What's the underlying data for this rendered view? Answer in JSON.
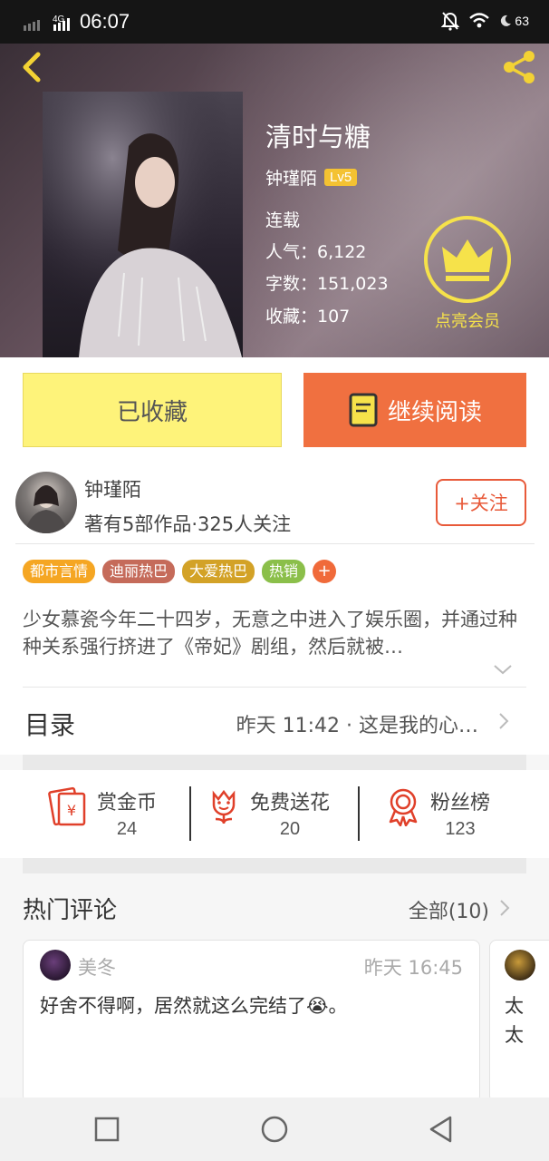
{
  "status_bar": {
    "network": "4G",
    "time": "06:07",
    "battery": "63"
  },
  "book": {
    "title": "清时与糖",
    "author": "钟瑾陌",
    "level": "Lv5",
    "status": "连载",
    "popularity": "人气：6,122",
    "word_count": "字数：151,023",
    "favorites": "收藏：107",
    "vip_label": "点亮会员"
  },
  "actions": {
    "favorited_label": "已收藏",
    "continue_label": "继续阅读"
  },
  "author_info": {
    "name": "钟瑾陌",
    "meta": "著有5部作品·325人关注",
    "follow_label": "+关注"
  },
  "tags": [
    {
      "label": "都市言情",
      "color": "#f5a623"
    },
    {
      "label": "迪丽热巴",
      "color": "#c56b5a"
    },
    {
      "label": "大爱热巴",
      "color": "#d3a227"
    },
    {
      "label": "热销",
      "color": "#8bbf4a"
    }
  ],
  "tag_more": "+",
  "description": "少女慕瓷今年二十四岁，无意之中进入了娱乐圈，并通过种种关系强行挤进了《帝妃》剧组，然后就被…",
  "toc": {
    "title": "目录",
    "latest": "昨天 11:42 · 这是我的心…"
  },
  "rewards": [
    {
      "label": "赏金币",
      "count": "24",
      "icon": "red-envelope-icon"
    },
    {
      "label": "免费送花",
      "count": "20",
      "icon": "flower-icon"
    },
    {
      "label": "粉丝榜",
      "count": "123",
      "icon": "medal-icon"
    }
  ],
  "hot_comments": {
    "title": "热门评论",
    "all_label": "全部(10)",
    "items": [
      {
        "user": "美冬",
        "time": "昨天 16:45",
        "text": "好舍不得啊，居然就这么完结了😭。"
      },
      {
        "text": "太太"
      }
    ]
  },
  "colors": {
    "accent_orange": "#f07040",
    "fav_yellow": "#fef37a",
    "vip_yellow": "#f6e24a",
    "red": "#e85a3a"
  }
}
